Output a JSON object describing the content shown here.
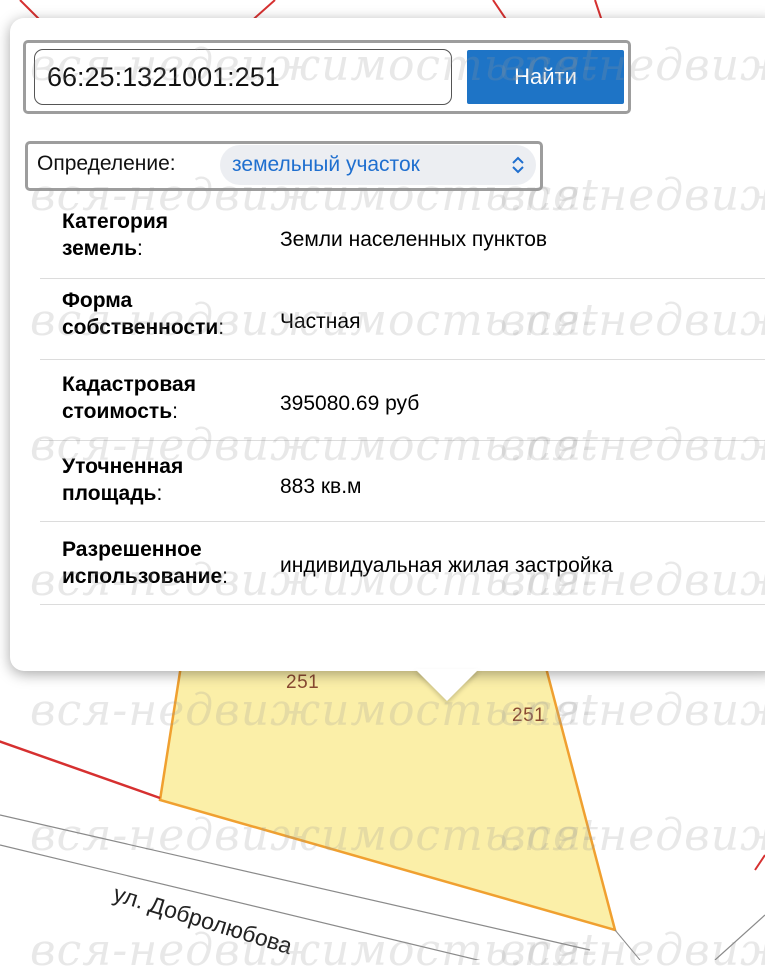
{
  "map": {
    "parcel_labels": [
      "251",
      "251"
    ],
    "street_name": "ул. Добролюбова",
    "colors": {
      "parcel_fill": "#fbefa8",
      "parcel_border": "#f0a030",
      "boundary_red": "#d63030"
    }
  },
  "search": {
    "input_value": "66:25:1321001:251",
    "button_label": "Найти"
  },
  "definition": {
    "label": "Определение:",
    "selected": "земельный участок"
  },
  "info": [
    {
      "key_bold": "Категория земель",
      "key_suffix": ":",
      "value": "Земли населенных пунктов"
    },
    {
      "key_bold": "Форма собственности",
      "key_suffix": ":",
      "value": "Частная"
    },
    {
      "key_bold": "Кадастровая стоимость",
      "key_suffix": ":",
      "value": "395080.69 руб"
    },
    {
      "key_bold": "Уточненная площадь",
      "key_suffix": ":",
      "value": "883 кв.м"
    },
    {
      "key_bold": "Разрешенное использование",
      "key_suffix": ":",
      "value": "индивидуальная жилая застройка"
    }
  ],
  "watermark_text": "вся-недвижимость.net",
  "colors": {
    "accent": "#1e74c6",
    "select_text": "#1f6fcf"
  }
}
